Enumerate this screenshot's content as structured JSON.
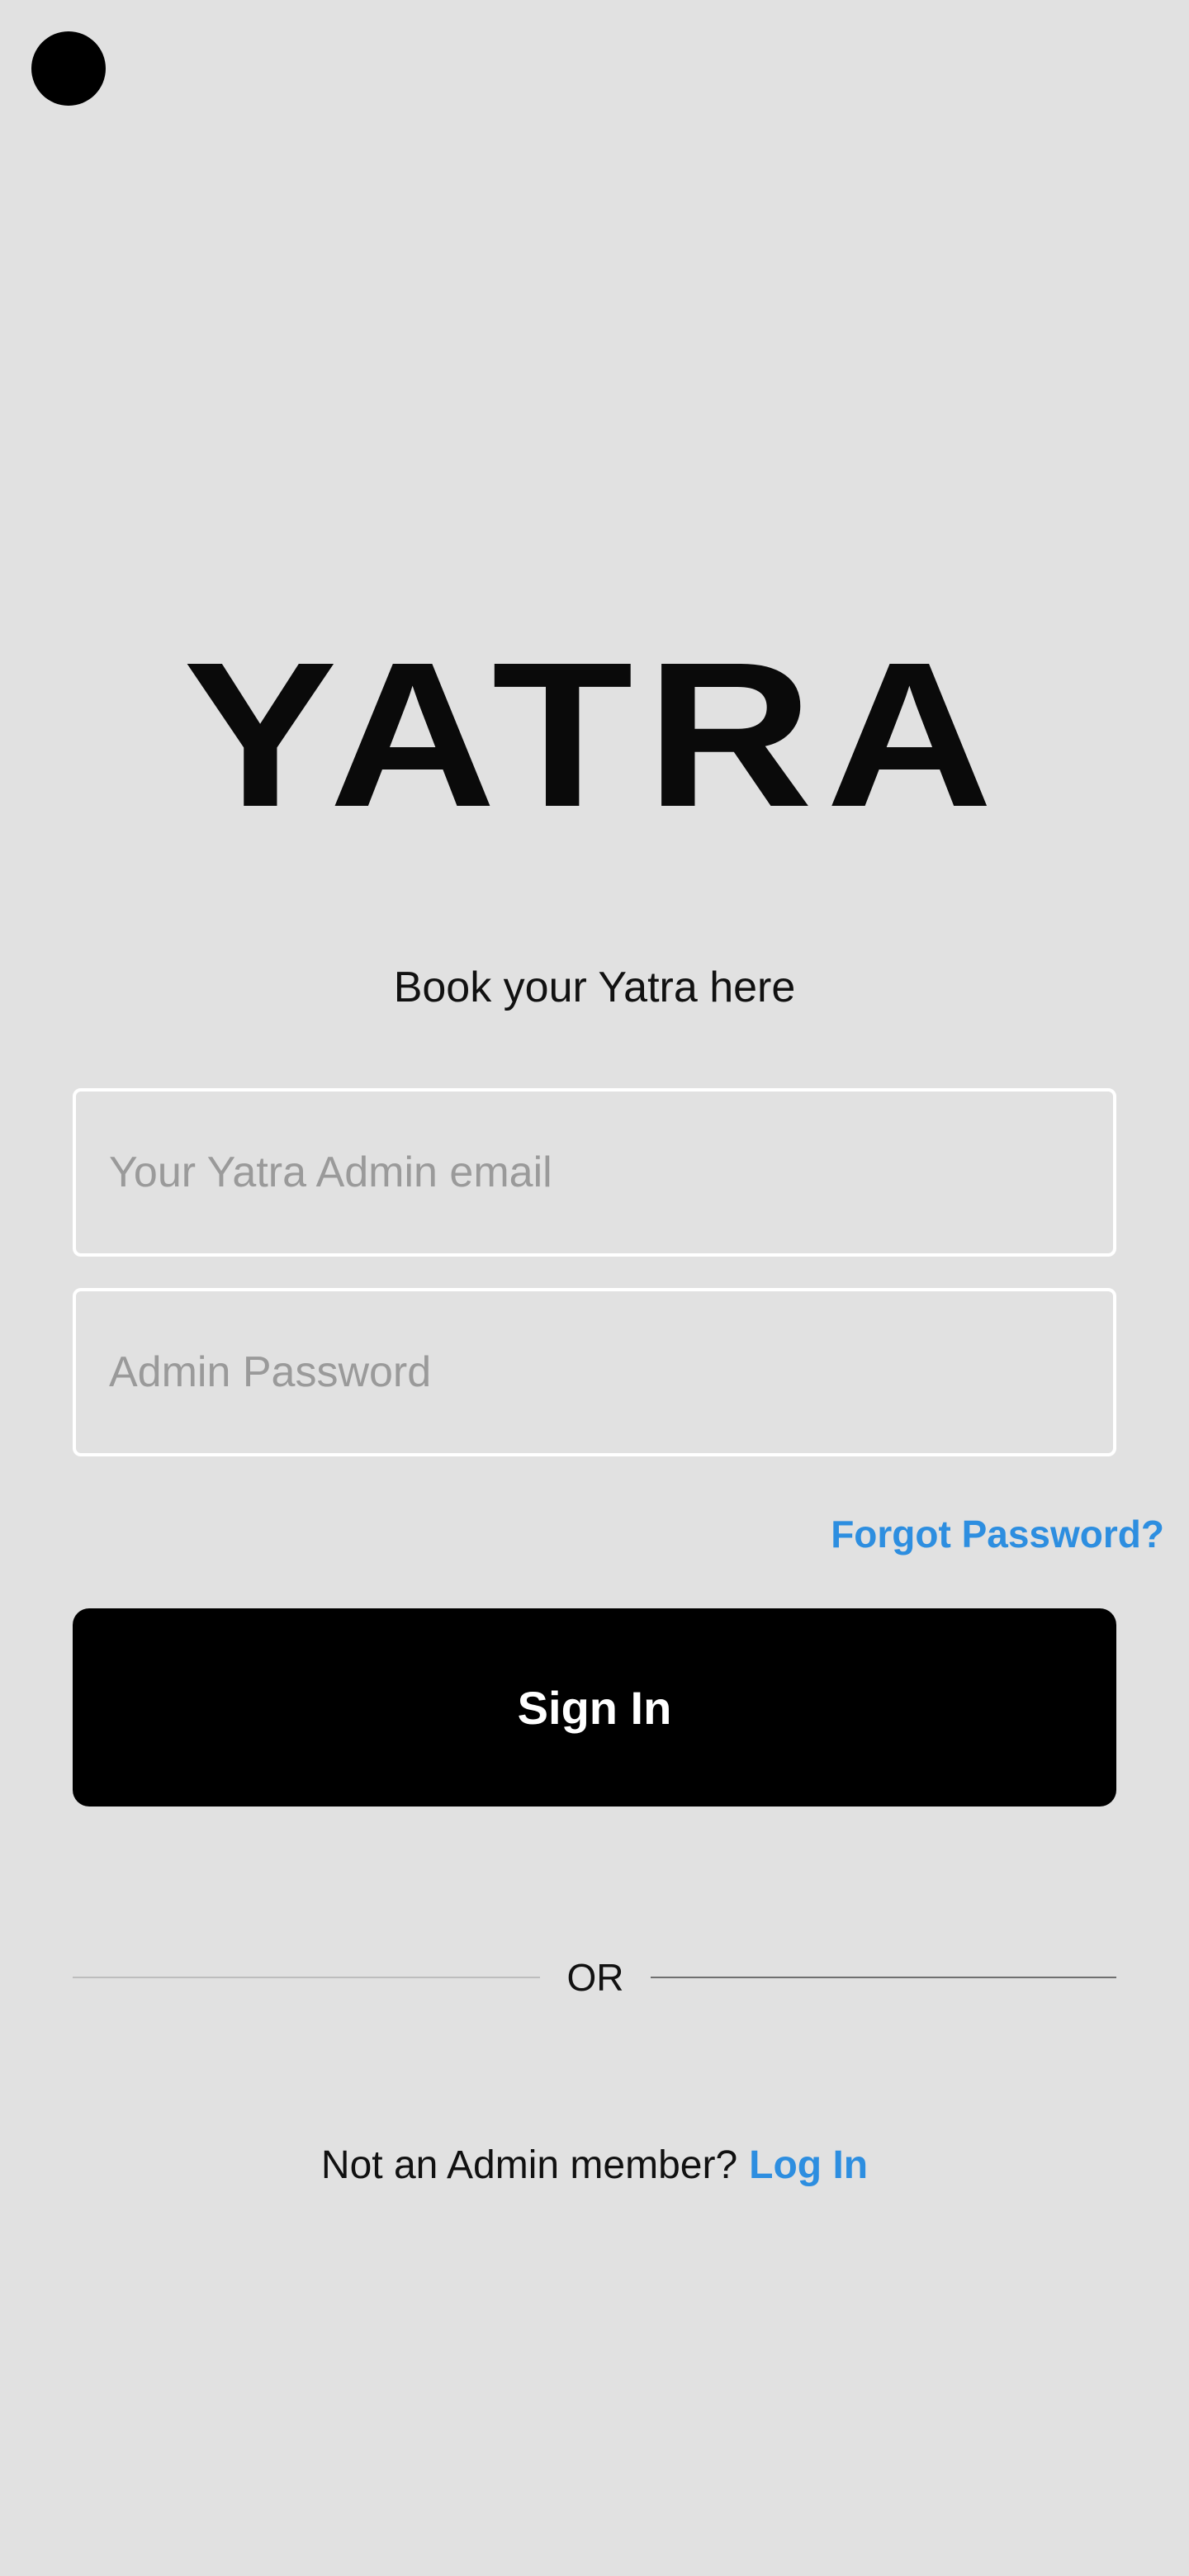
{
  "brand": {
    "logo_text": "YATRA",
    "tagline": "Book your Yatra here"
  },
  "form": {
    "email_placeholder": "Your Yatra Admin email",
    "password_placeholder": "Admin Password",
    "email_value": "",
    "password_value": "",
    "forgot_password_label": "Forgot Password?",
    "signin_label": "Sign In"
  },
  "divider": {
    "label": "OR"
  },
  "footer": {
    "prompt": "Not an Admin member?",
    "login_label": "Log In"
  },
  "colors": {
    "background": "#e1e1e1",
    "accent_link": "#2d8ee0",
    "button": "#000000",
    "button_text": "#ffffff"
  },
  "icons": {
    "status": "camera-dot-icon"
  }
}
